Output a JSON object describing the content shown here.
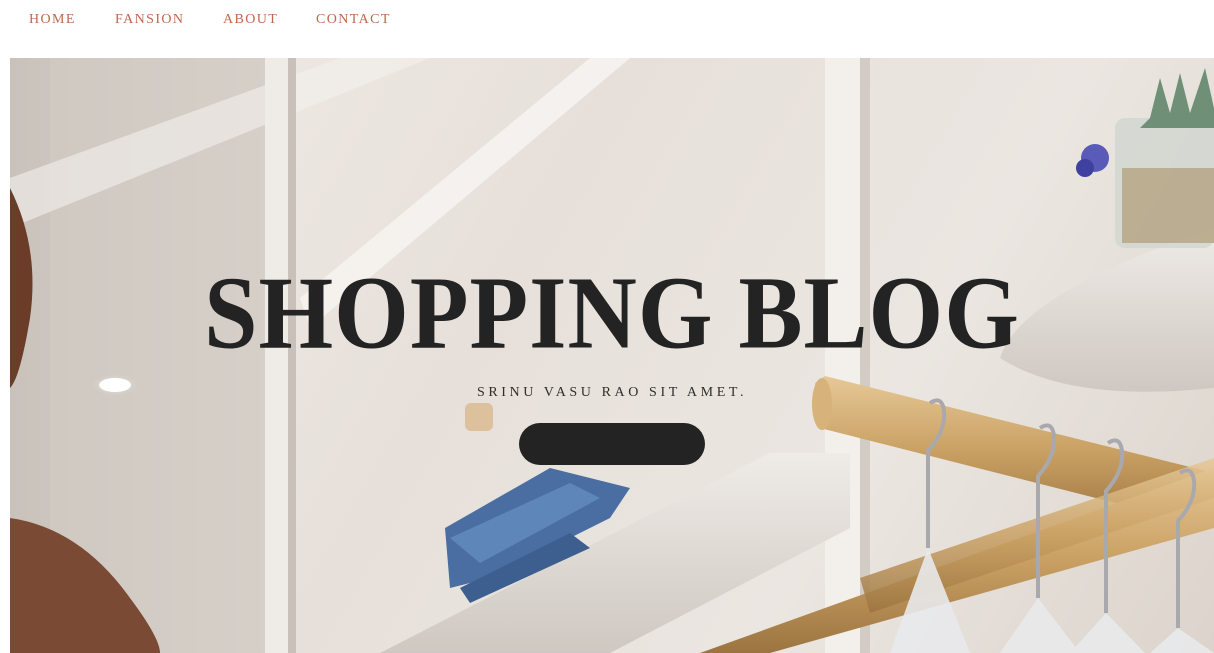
{
  "nav": {
    "items": [
      {
        "label": "HOME"
      },
      {
        "label": "FANSION"
      },
      {
        "label": "ABOUT"
      },
      {
        "label": "CONTACT"
      }
    ]
  },
  "hero": {
    "title": "SHOPPING BLOG",
    "subtitle": "SRINU VASU RAO SIT AMET.",
    "button_label": ""
  },
  "colors": {
    "nav_text": "#c0674e",
    "title": "#232323",
    "button": "#232323"
  }
}
